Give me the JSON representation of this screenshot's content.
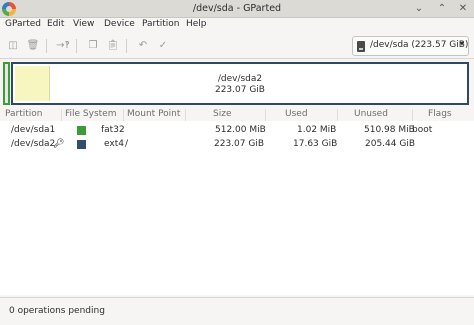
{
  "window": {
    "title": "/dev/sda - GParted"
  },
  "menubar": {
    "items": [
      "GParted",
      "Edit",
      "View",
      "Device",
      "Partition",
      "Help"
    ]
  },
  "toolbar": {
    "icons": [
      "new-partition-icon",
      "delete-partition-icon",
      "resize-move-icon",
      "copy-icon",
      "paste-icon",
      "undo-icon",
      "apply-icon"
    ],
    "device": "/dev/sda (223.57 GiB)"
  },
  "diskmap": {
    "partition_name": "/dev/sda2",
    "partition_size": "223.07 GiB"
  },
  "table": {
    "headers": [
      "Partition",
      "File System",
      "Mount Point",
      "Size",
      "Used",
      "Unused",
      "Flags"
    ],
    "rows": [
      {
        "partition": "/dev/sda1",
        "fs_color": "#3d9b38",
        "filesystem": "fat32",
        "mount": "",
        "size": "512.00 MiB",
        "used": "1.02 MiB",
        "unused": "510.98 MiB",
        "flags": "boot",
        "locked": false
      },
      {
        "partition": "/dev/sda2",
        "fs_color": "#314e6a",
        "filesystem": "ext4",
        "mount": "/",
        "size": "223.07 GiB",
        "used": "17.63 GiB",
        "unused": "205.44 GiB",
        "flags": "",
        "locked": true
      }
    ]
  },
  "status": {
    "text": "0 operations pending"
  }
}
